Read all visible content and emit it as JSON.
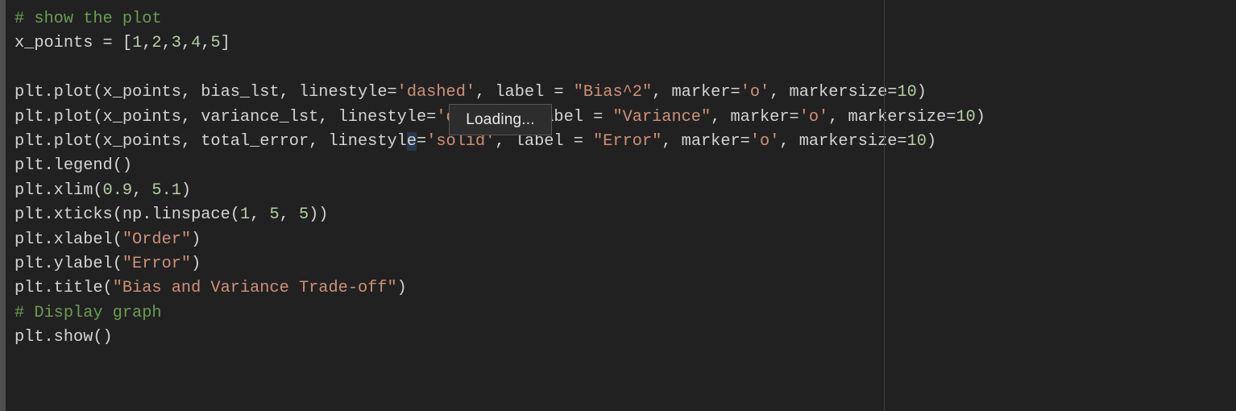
{
  "editor": {
    "background_color": "#212121",
    "gutter_color": "#4f4f4f",
    "ruler_color": "#3d3d3d",
    "colors": {
      "plain_text": "#d4d4d4",
      "comment": "#6a9b52",
      "string": "#ce9178",
      "number": "#b5cea8",
      "selection": "#26384b"
    },
    "lines": [
      {
        "id": "l1",
        "tokens": [
          {
            "t": "# show the plot",
            "c": "cm"
          }
        ]
      },
      {
        "id": "l2",
        "tokens": [
          {
            "t": "x_points = [",
            "c": "pl"
          },
          {
            "t": "1",
            "c": "num"
          },
          {
            "t": ",",
            "c": "pl"
          },
          {
            "t": "2",
            "c": "num"
          },
          {
            "t": ",",
            "c": "pl"
          },
          {
            "t": "3",
            "c": "num"
          },
          {
            "t": ",",
            "c": "pl"
          },
          {
            "t": "4",
            "c": "num"
          },
          {
            "t": ",",
            "c": "pl"
          },
          {
            "t": "5",
            "c": "num"
          },
          {
            "t": "]",
            "c": "pl"
          }
        ]
      },
      {
        "id": "l3",
        "tokens": [
          {
            "t": "",
            "c": "pl"
          }
        ]
      },
      {
        "id": "l4",
        "tokens": [
          {
            "t": "plt.plot(x_points, bias_lst, linestyle=",
            "c": "pl"
          },
          {
            "t": "'dashed'",
            "c": "st"
          },
          {
            "t": ", label = ",
            "c": "pl"
          },
          {
            "t": "\"Bias^2\"",
            "c": "st"
          },
          {
            "t": ", marker=",
            "c": "pl"
          },
          {
            "t": "'o'",
            "c": "st"
          },
          {
            "t": ", markersize=",
            "c": "pl"
          },
          {
            "t": "10",
            "c": "num"
          },
          {
            "t": ")",
            "c": "pl"
          }
        ]
      },
      {
        "id": "l5",
        "tokens": [
          {
            "t": "plt.plot(x_points, variance_lst, linestyle=",
            "c": "pl"
          },
          {
            "t": "'dashed'",
            "c": "st"
          },
          {
            "t": ", label = ",
            "c": "pl"
          },
          {
            "t": "\"Variance\"",
            "c": "st"
          },
          {
            "t": ", marker=",
            "c": "pl"
          },
          {
            "t": "'o'",
            "c": "st"
          },
          {
            "t": ", markersize=",
            "c": "pl"
          },
          {
            "t": "10",
            "c": "num"
          },
          {
            "t": ")",
            "c": "pl"
          }
        ]
      },
      {
        "id": "l6",
        "tokens": [
          {
            "t": "plt.plot(x_points, total_error, linestyl",
            "c": "pl"
          },
          {
            "t": "e",
            "c": "sel"
          },
          {
            "t": "=",
            "c": "pl"
          },
          {
            "t": "'solid'",
            "c": "st"
          },
          {
            "t": ", label = ",
            "c": "pl"
          },
          {
            "t": "\"Error\"",
            "c": "st"
          },
          {
            "t": ", marker=",
            "c": "pl"
          },
          {
            "t": "'o'",
            "c": "st"
          },
          {
            "t": ", markersize=",
            "c": "pl"
          },
          {
            "t": "10",
            "c": "num"
          },
          {
            "t": ")",
            "c": "pl"
          }
        ]
      },
      {
        "id": "l7",
        "tokens": [
          {
            "t": "plt.legend()",
            "c": "pl"
          }
        ]
      },
      {
        "id": "l8",
        "tokens": [
          {
            "t": "plt.xlim(",
            "c": "pl"
          },
          {
            "t": "0.9",
            "c": "num"
          },
          {
            "t": ", ",
            "c": "pl"
          },
          {
            "t": "5.1",
            "c": "num"
          },
          {
            "t": ")",
            "c": "pl"
          }
        ]
      },
      {
        "id": "l9",
        "tokens": [
          {
            "t": "plt.xticks(np.linspace(",
            "c": "pl"
          },
          {
            "t": "1",
            "c": "num"
          },
          {
            "t": ", ",
            "c": "pl"
          },
          {
            "t": "5",
            "c": "num"
          },
          {
            "t": ", ",
            "c": "pl"
          },
          {
            "t": "5",
            "c": "num"
          },
          {
            "t": "))",
            "c": "pl"
          }
        ]
      },
      {
        "id": "l10",
        "tokens": [
          {
            "t": "plt.xlabel(",
            "c": "pl"
          },
          {
            "t": "\"Order\"",
            "c": "st"
          },
          {
            "t": ")",
            "c": "pl"
          }
        ]
      },
      {
        "id": "l11",
        "tokens": [
          {
            "t": "plt.ylabel(",
            "c": "pl"
          },
          {
            "t": "\"Error\"",
            "c": "st"
          },
          {
            "t": ")",
            "c": "pl"
          }
        ]
      },
      {
        "id": "l12",
        "tokens": [
          {
            "t": "plt.title(",
            "c": "pl"
          },
          {
            "t": "\"Bias and Variance Trade-off\"",
            "c": "st"
          },
          {
            "t": ")",
            "c": "pl"
          }
        ]
      },
      {
        "id": "l13",
        "tokens": [
          {
            "t": "# Display graph",
            "c": "cm"
          }
        ]
      },
      {
        "id": "l14",
        "tokens": [
          {
            "t": "plt.show()",
            "c": "pl"
          }
        ]
      }
    ]
  },
  "overlay": {
    "loading_tooltip": {
      "label": "Loading...",
      "background_color": "#2d2d2d",
      "border_color": "#565656"
    }
  }
}
